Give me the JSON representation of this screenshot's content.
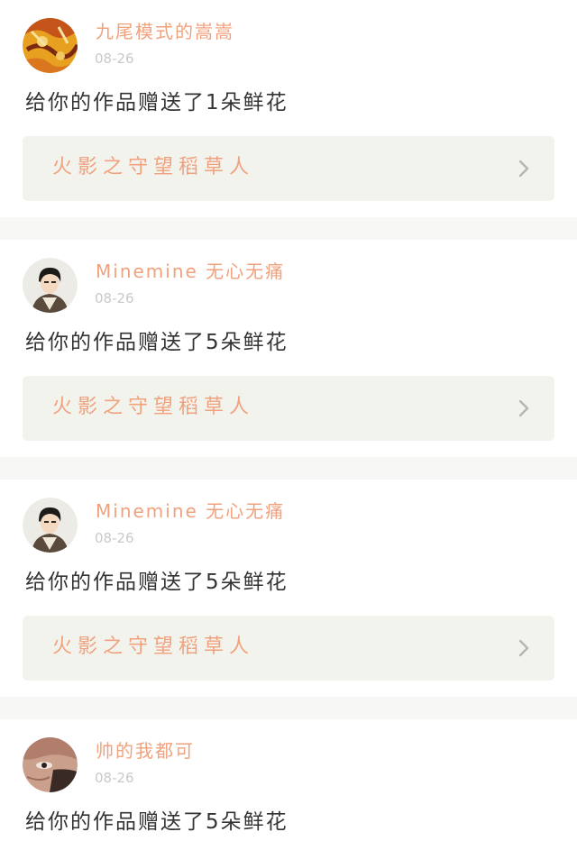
{
  "feed": {
    "items": [
      {
        "username": "九尾模式的嵩嵩",
        "date": "08-26",
        "message": "给你的作品赠送了1朵鲜花",
        "work_title": "火影之守望稻草人",
        "avatar_icon": "orange-pattern-avatar"
      },
      {
        "username": "Minemine 无心无痛",
        "date": "08-26",
        "message": "给你的作品赠送了5朵鲜花",
        "work_title": "火影之守望稻草人",
        "avatar_icon": "anime-boy-avatar"
      },
      {
        "username": "Minemine 无心无痛",
        "date": "08-26",
        "message": "给你的作品赠送了5朵鲜花",
        "work_title": "火影之守望稻草人",
        "avatar_icon": "anime-boy-avatar"
      },
      {
        "username": "帅的我都可",
        "date": "08-26",
        "message": "给你的作品赠送了5朵鲜花",
        "avatar_icon": "masked-face-avatar"
      }
    ]
  },
  "colors": {
    "username": "#f0a27e",
    "date": "#c9c9c9",
    "message": "#333333",
    "link_background": "#f3f3ed",
    "separator": "#f7f7f5"
  }
}
